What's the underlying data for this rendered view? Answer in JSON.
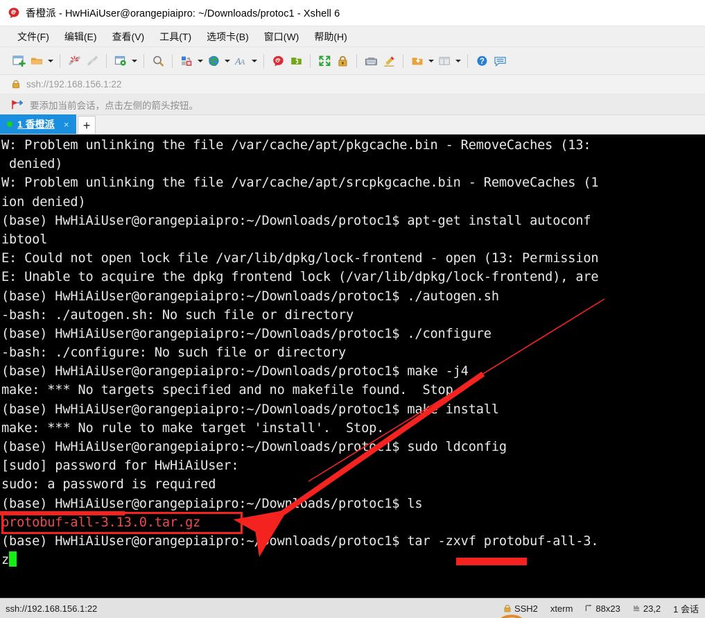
{
  "window": {
    "title": "香橙派 - HwHiAiUser@orangepiaipro: ~/Downloads/protoc1 - Xshell 6",
    "app_icon": "xshell-logo-icon"
  },
  "menubar": {
    "items": [
      {
        "label": "文件(F)",
        "name": "menu-file"
      },
      {
        "label": "编辑(E)",
        "name": "menu-edit"
      },
      {
        "label": "查看(V)",
        "name": "menu-view"
      },
      {
        "label": "工具(T)",
        "name": "menu-tools"
      },
      {
        "label": "选项卡(B)",
        "name": "menu-tabs"
      },
      {
        "label": "窗口(W)",
        "name": "menu-window"
      },
      {
        "label": "帮助(H)",
        "name": "menu-help"
      }
    ]
  },
  "toolbar": {
    "items": [
      {
        "icon": "new-session-icon",
        "caret": false
      },
      {
        "icon": "open-folder-icon",
        "caret": true
      },
      {
        "sep": true
      },
      {
        "icon": "disconnect-icon",
        "caret": false
      },
      {
        "icon": "reconnect-link-icon",
        "caret": false
      },
      {
        "sep": true
      },
      {
        "icon": "session-properties-icon",
        "caret": true
      },
      {
        "sep": true
      },
      {
        "icon": "find-icon",
        "caret": false
      },
      {
        "sep": true
      },
      {
        "icon": "transfer-file-icon",
        "caret": true
      },
      {
        "icon": "globe-icon",
        "caret": true
      },
      {
        "icon": "font-format-icon",
        "caret": true
      },
      {
        "sep": true
      },
      {
        "icon": "xshell-red-icon",
        "caret": false
      },
      {
        "icon": "xftp-green-icon",
        "caret": false
      },
      {
        "sep": true
      },
      {
        "icon": "fullscreen-icon",
        "caret": false
      },
      {
        "icon": "lock-icon",
        "caret": false
      },
      {
        "sep": true
      },
      {
        "icon": "keyboard-icon",
        "caret": false
      },
      {
        "icon": "highlighter-icon",
        "caret": false
      },
      {
        "sep": true
      },
      {
        "icon": "add-to-folder-icon",
        "caret": true
      },
      {
        "icon": "layout-icon",
        "caret": true
      },
      {
        "sep": true
      },
      {
        "icon": "help-icon",
        "caret": false
      },
      {
        "icon": "chat-icon",
        "caret": false
      }
    ]
  },
  "address_bar": {
    "icon": "lock-icon",
    "value": "ssh://192.168.156.1:22"
  },
  "hint_bar": {
    "icon": "red-arrow-flag-icon",
    "text": "要添加当前会话，点击左侧的箭头按钮。"
  },
  "tabs": {
    "active": {
      "label": "1 香橙派",
      "status": "connected",
      "close": "×"
    },
    "new_tab_label": "+"
  },
  "terminal": {
    "lines": [
      {
        "segments": [
          {
            "text": "W: Problem unlinking the file /var/cache/apt/pkgcache.bin - RemoveCaches (13:"
          }
        ]
      },
      {
        "segments": [
          {
            "text": " denied)"
          }
        ]
      },
      {
        "segments": [
          {
            "text": "W: Problem unlinking the file /var/cache/apt/srcpkgcache.bin - RemoveCaches (1"
          }
        ]
      },
      {
        "segments": [
          {
            "text": "ion denied)"
          }
        ]
      },
      {
        "segments": [
          {
            "text": "(base) HwHiAiUser@orangepiaipro:~/Downloads/protoc1$ apt-get install autoconf"
          }
        ]
      },
      {
        "segments": [
          {
            "text": "ibtool"
          }
        ]
      },
      {
        "segments": [
          {
            "text": "E: Could not open lock file /var/lib/dpkg/lock-frontend - open (13: Permission"
          }
        ]
      },
      {
        "segments": [
          {
            "text": "E: Unable to acquire the dpkg frontend lock (/var/lib/dpkg/lock-frontend), are"
          }
        ]
      },
      {
        "segments": [
          {
            "text": "(base) HwHiAiUser@orangepiaipro:~/Downloads/protoc1$ ./autogen.sh"
          }
        ]
      },
      {
        "segments": [
          {
            "text": "-bash: ./autogen.sh: No such file or directory"
          }
        ]
      },
      {
        "segments": [
          {
            "text": "(base) HwHiAiUser@orangepiaipro:~/Downloads/protoc1$ ./configure"
          }
        ]
      },
      {
        "segments": [
          {
            "text": "-bash: ./configure: No such file or directory"
          }
        ]
      },
      {
        "segments": [
          {
            "text": "(base) HwHiAiUser@orangepiaipro:~/Downloads/protoc1$ make -j4"
          }
        ]
      },
      {
        "segments": [
          {
            "text": "make: *** No targets specified and no makefile found.  Stop."
          }
        ]
      },
      {
        "segments": [
          {
            "text": "(base) HwHiAiUser@orangepiaipro:~/Downloads/protoc1$ make install"
          }
        ]
      },
      {
        "segments": [
          {
            "text": "make: *** No rule to make target 'install'.  Stop."
          }
        ]
      },
      {
        "segments": [
          {
            "text": "(base) HwHiAiUser@orangepiaipro:~/Downloads/protoc1$ sudo ldconfig"
          }
        ]
      },
      {
        "segments": [
          {
            "text": "[sudo] password for HwHiAiUser:"
          }
        ]
      },
      {
        "segments": [
          {
            "text": "sudo: a password is required"
          }
        ]
      },
      {
        "segments": [
          {
            "text": "(base) HwHiAiUser@orangepiaipro:~/Downloads/protoc1$ ls"
          }
        ]
      },
      {
        "segments": [
          {
            "text": "protobuf-all-3.13.0.tar.gz",
            "color": "red"
          }
        ]
      },
      {
        "segments": [
          {
            "text": "(base) HwHiAiUser@orangepiaipro:~/Downloads/protoc1$ tar -zxvf protobuf-all-3."
          }
        ]
      },
      {
        "segments": [
          {
            "text": "z"
          }
        ],
        "cursor": true
      }
    ]
  },
  "annotations": {
    "arrow_color": "#f5231f",
    "highlight_box_label": "protobuf-all-3.13.0.tar.gz",
    "arrow_from": "./autogen.sh line",
    "arrow_to": "ls command prompt line"
  },
  "statusbar": {
    "connection": "ssh://192.168.156.1:22",
    "cells": [
      {
        "icon": "lock-icon",
        "label": "SSH2",
        "name": "status-protocol"
      },
      {
        "icon": "",
        "label": "xterm",
        "name": "status-terminal-type"
      },
      {
        "icon": "size-icon",
        "label": "88x23",
        "name": "status-size"
      },
      {
        "icon": "cursor-icon",
        "label": "23,2",
        "name": "status-cursor-pos"
      },
      {
        "icon": "",
        "label": "1 会话",
        "name": "status-session-count"
      }
    ]
  },
  "colors": {
    "accent": "#1a8fe0",
    "annotation_red": "#f5231f",
    "terminal_bg": "#000000",
    "terminal_fg": "#e8e8e8",
    "cursor_green": "#15ee15",
    "archive_red": "#f04b4b"
  }
}
